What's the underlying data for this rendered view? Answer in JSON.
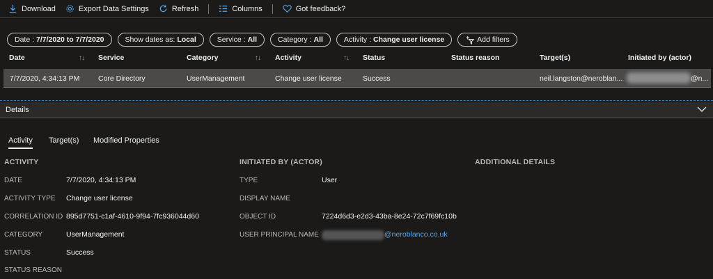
{
  "toolbar": {
    "download": "Download",
    "export": "Export Data Settings",
    "refresh": "Refresh",
    "columns": "Columns",
    "feedback": "Got feedback?"
  },
  "filters": {
    "date_label": "Date :",
    "date_value": "7/7/2020 to 7/7/2020",
    "show_dates_label": "Show dates as:",
    "show_dates_value": "Local",
    "service_label": "Service :",
    "service_value": "All",
    "category_label": "Category :",
    "category_value": "All",
    "activity_label": "Activity :",
    "activity_value": "Change user license",
    "add_filters": "Add filters"
  },
  "table": {
    "headers": [
      "Date",
      "Service",
      "Category",
      "Activity",
      "Status",
      "Status reason",
      "Target(s)",
      "Initiated by (actor)"
    ],
    "row": {
      "date": "7/7/2020, 4:34:13 PM",
      "service": "Core Directory",
      "category": "UserManagement",
      "activity": "Change user license",
      "status": "Success",
      "status_reason": "",
      "targets": "neil.langston@neroblan...",
      "initiated_by": "@n..."
    }
  },
  "details": {
    "title": "Details",
    "tabs": [
      "Activity",
      "Target(s)",
      "Modified Properties"
    ],
    "activity": {
      "heading": "ACTIVITY",
      "date_label": "DATE",
      "date_value": "7/7/2020, 4:34:13 PM",
      "type_label": "ACTIVITY TYPE",
      "type_value": "Change user license",
      "correlation_label": "CORRELATION ID",
      "correlation_value": "895d7751-c1af-4610-9f94-7fc936044d60",
      "category_label": "CATEGORY",
      "category_value": "UserManagement",
      "status_label": "STATUS",
      "status_value": "Success",
      "status_reason_label": "STATUS REASON"
    },
    "actor": {
      "heading": "INITIATED BY (ACTOR)",
      "type_label": "TYPE",
      "type_value": "User",
      "display_name_label": "DISPLAY NAME",
      "object_id_label": "OBJECT ID",
      "object_id_value": "7224d6d3-e2d3-43ba-8e24-72c7f69fc10b",
      "upn_label": "USER PRINCIPAL NAME",
      "upn_value": "@neroblanco.co.uk"
    },
    "additional": {
      "heading": "ADDITIONAL DETAILS"
    }
  },
  "colors": {
    "background": "#1b1a19",
    "selected_row": "#4b4a49",
    "link": "#5aa5e6",
    "accent": "#2f86c8"
  }
}
